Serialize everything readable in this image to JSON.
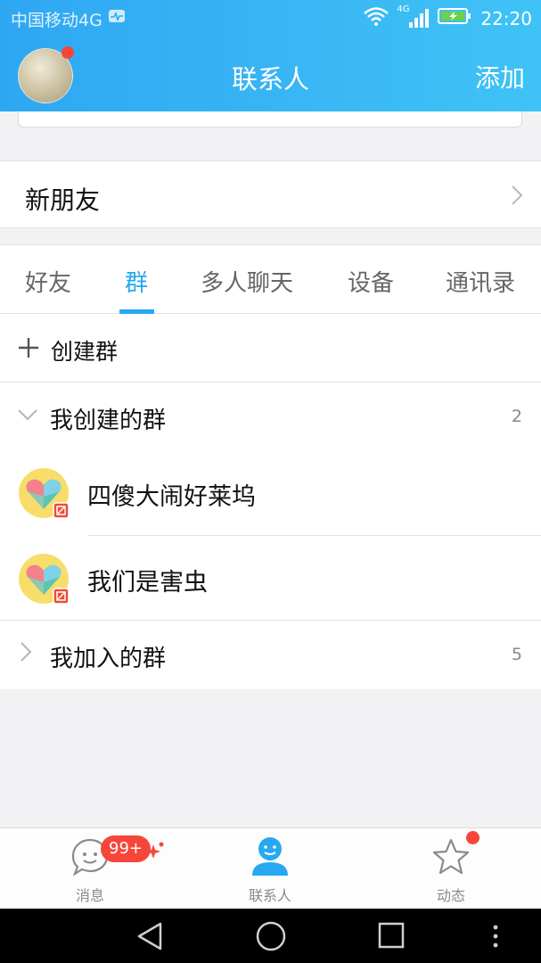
{
  "status_bar": {
    "carrier": "中国移动4G",
    "network": "4G",
    "time": "22:20",
    "icons": [
      "health-icon",
      "wifi-icon",
      "signal-icon",
      "battery-charging-icon"
    ]
  },
  "header": {
    "title": "联系人",
    "add_label": "添加",
    "accent_color": "#2ea7f3"
  },
  "new_friends": {
    "label": "新朋友"
  },
  "tabs": [
    {
      "label": "好友",
      "active": false
    },
    {
      "label": "群",
      "active": true
    },
    {
      "label": "多人聊天",
      "active": false
    },
    {
      "label": "设备",
      "active": false
    },
    {
      "label": "通讯录",
      "active": false
    }
  ],
  "groups": {
    "create_label": "创建群",
    "created": {
      "label": "我创建的群",
      "count": "2",
      "expanded": true,
      "items": [
        {
          "name": "四傻大闹好莱坞"
        },
        {
          "name": "我们是害虫"
        }
      ]
    },
    "joined": {
      "label": "我加入的群",
      "count": "5",
      "expanded": false
    }
  },
  "tabbar": {
    "items": [
      {
        "label": "消息",
        "icon": "chat-bubble-icon",
        "badge": "99+",
        "active": false
      },
      {
        "label": "联系人",
        "icon": "contact-person-icon",
        "active": true
      },
      {
        "label": "动态",
        "icon": "star-icon",
        "active": false
      }
    ]
  },
  "nav_buttons": [
    "back-icon",
    "home-icon",
    "recents-icon",
    "menu-dots-icon"
  ]
}
